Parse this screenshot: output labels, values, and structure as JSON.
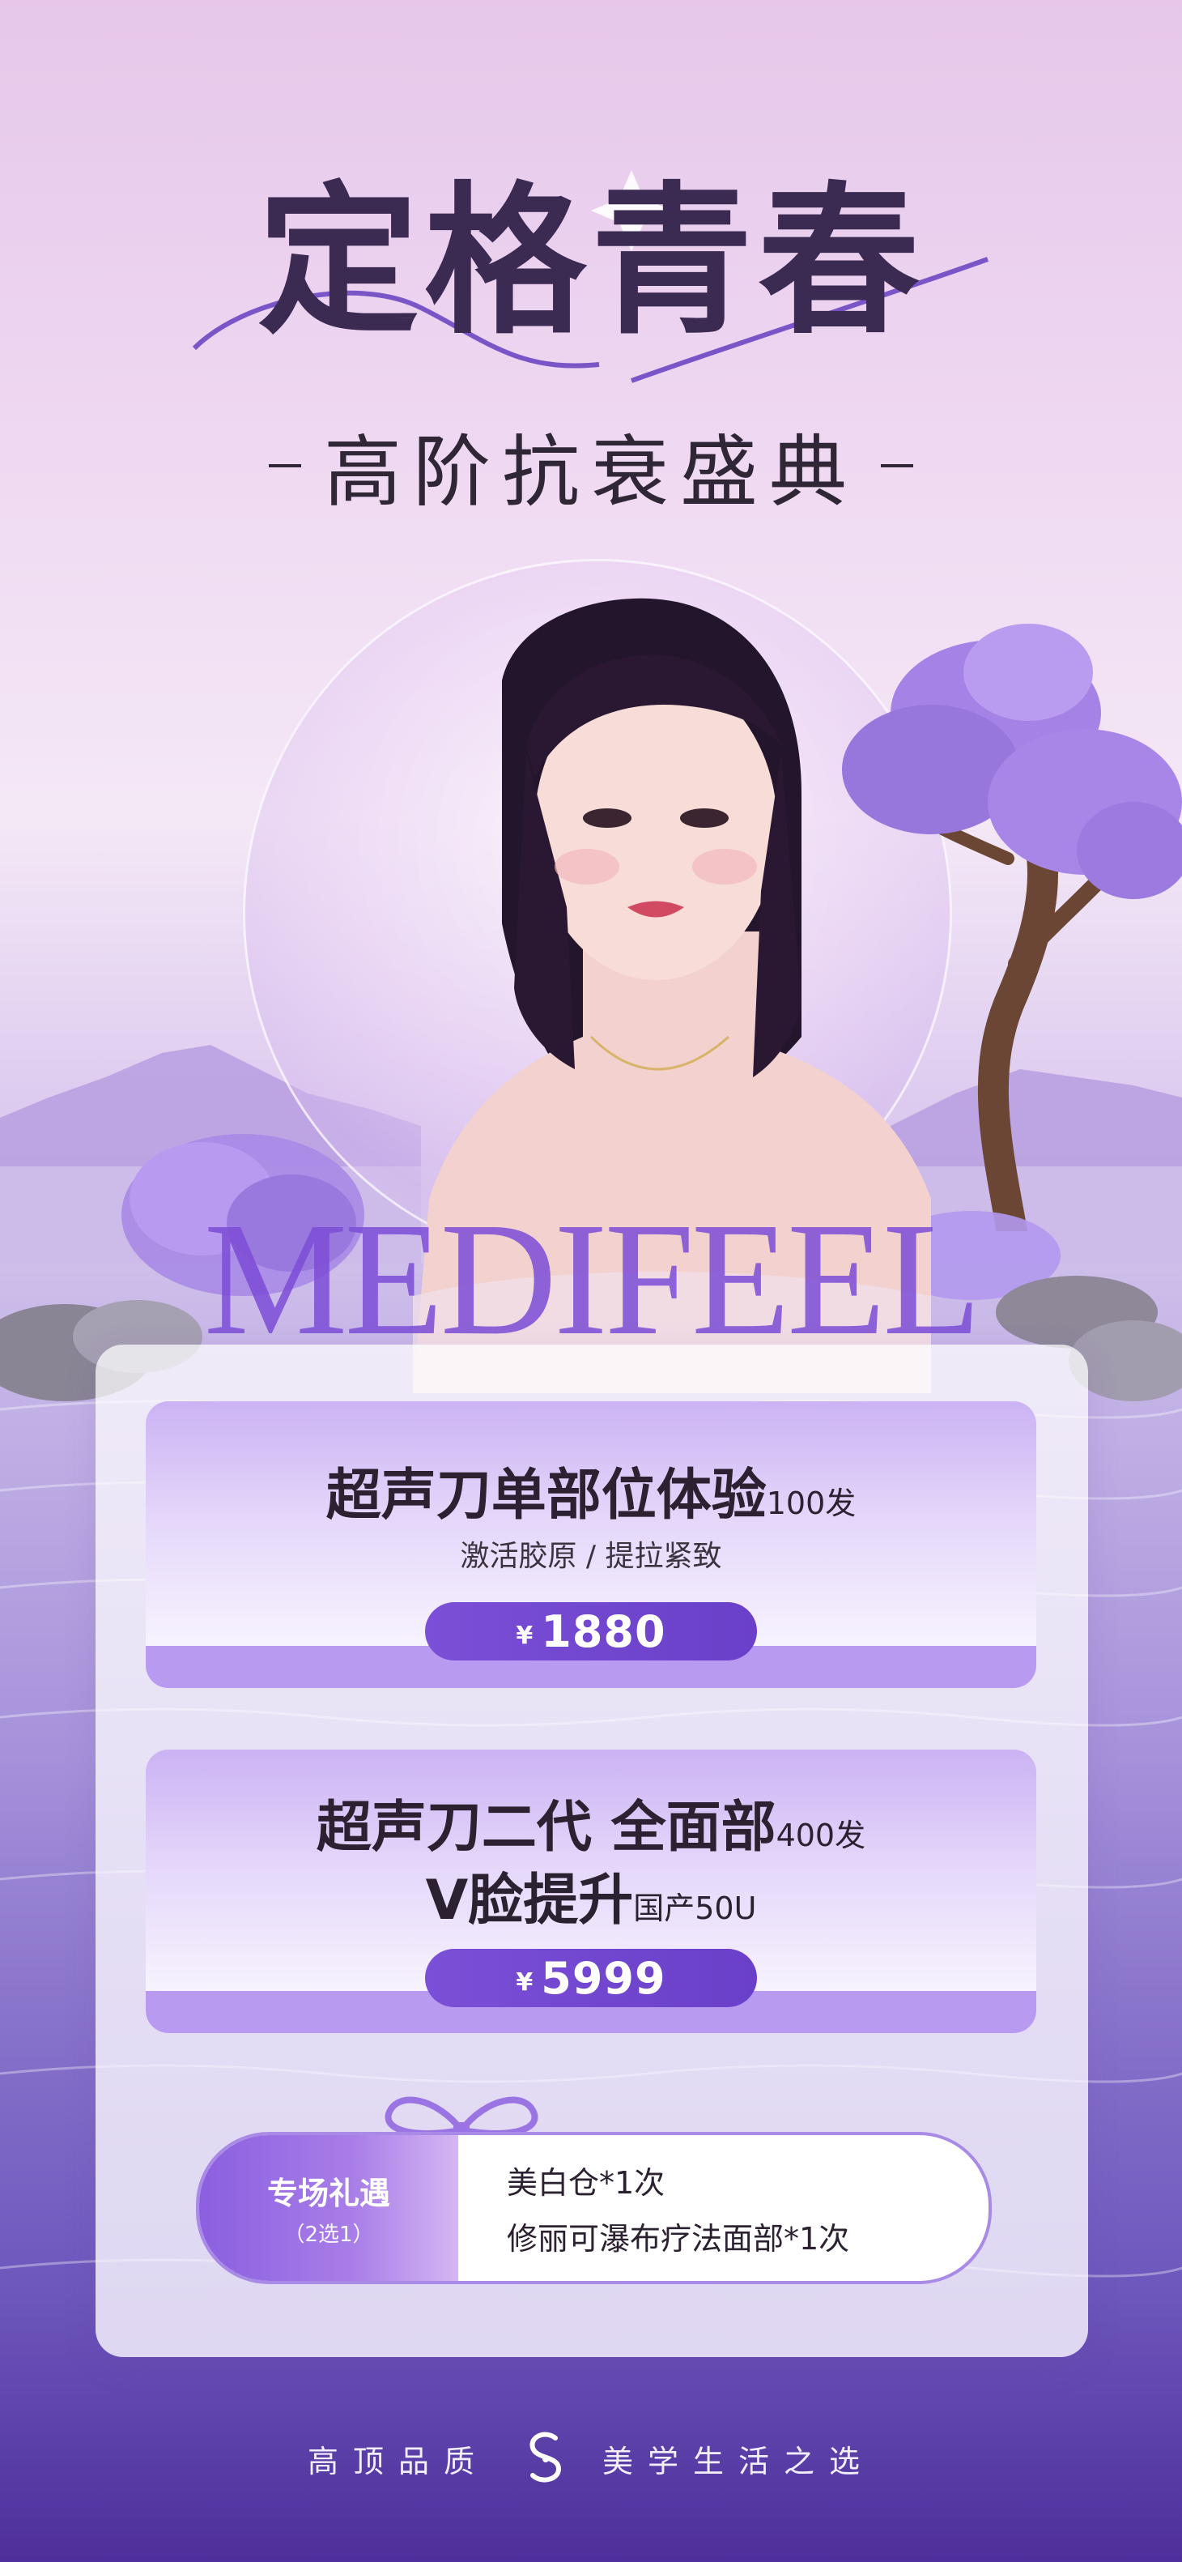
{
  "header": {
    "title": "定格青春",
    "subtitle": "高阶抗衰盛典"
  },
  "brand": {
    "wordmark": "MEDIFEEL"
  },
  "offers": [
    {
      "title": "超声刀单部位体验",
      "title_suffix": "100发",
      "subtitle": "激活胶原 / 提拉紧致",
      "currency": "¥",
      "price": "1880"
    },
    {
      "title_line1": "超声刀二代 全面部",
      "title_line1_suffix": "400发",
      "title_line2": "V脸提升",
      "title_line2_suffix": "国产50U",
      "currency": "¥",
      "price": "5999"
    }
  ],
  "gift": {
    "title": "专场礼遇",
    "note": "（2选1）",
    "items": [
      "美白仓*1次",
      "修丽可瀑布疗法面部*1次"
    ]
  },
  "footer": {
    "left": "高顶品质",
    "right": "美学生活之选",
    "logo_icon": "brand-s-logo-icon"
  },
  "colors": {
    "accent": "#7b4fd6",
    "band": "#b89bf0",
    "text_dark": "#2b2130"
  }
}
